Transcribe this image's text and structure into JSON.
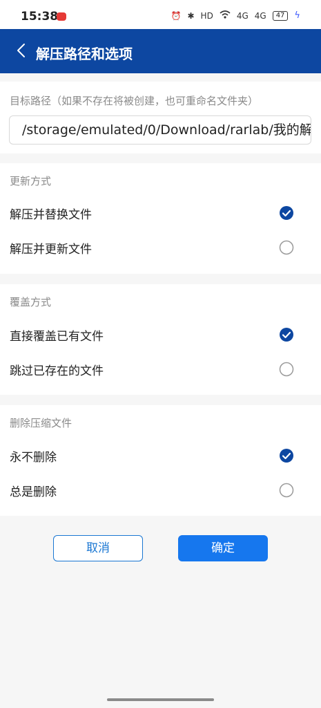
{
  "status_bar": {
    "time": "15:38",
    "battery": "47",
    "icons": [
      "alarm-icon",
      "bluetooth-icon",
      "hd-icon",
      "wifi-icon",
      "signal-4g-icon",
      "signal-4g-icon",
      "battery-icon",
      "charging-icon"
    ],
    "hd_label": "HD",
    "network_label_1": "4G",
    "network_label_2": "4G"
  },
  "app_bar": {
    "title": "解压路径和选项"
  },
  "destination": {
    "label": "目标路径（如果不存在将被创建，也可重命名文件夹）",
    "value": "/storage/emulated/0/Download/rarlab/我的解"
  },
  "update_mode": {
    "label": "更新方式",
    "options": [
      {
        "label": "解压并替换文件",
        "selected": true
      },
      {
        "label": "解压并更新文件",
        "selected": false
      }
    ]
  },
  "overwrite_mode": {
    "label": "覆盖方式",
    "options": [
      {
        "label": "直接覆盖已有文件",
        "selected": true
      },
      {
        "label": "跳过已存在的文件",
        "selected": false
      }
    ]
  },
  "delete_archive": {
    "label": "删除压缩文件",
    "options": [
      {
        "label": "永不删除",
        "selected": true
      },
      {
        "label": "总是删除",
        "selected": false
      }
    ]
  },
  "buttons": {
    "cancel": "取消",
    "ok": "确定"
  },
  "colors": {
    "app_bar": "#0d47a1",
    "accent": "#0d47a1",
    "primary_button": "#1677ee",
    "cancel_border": "#1976d2"
  }
}
